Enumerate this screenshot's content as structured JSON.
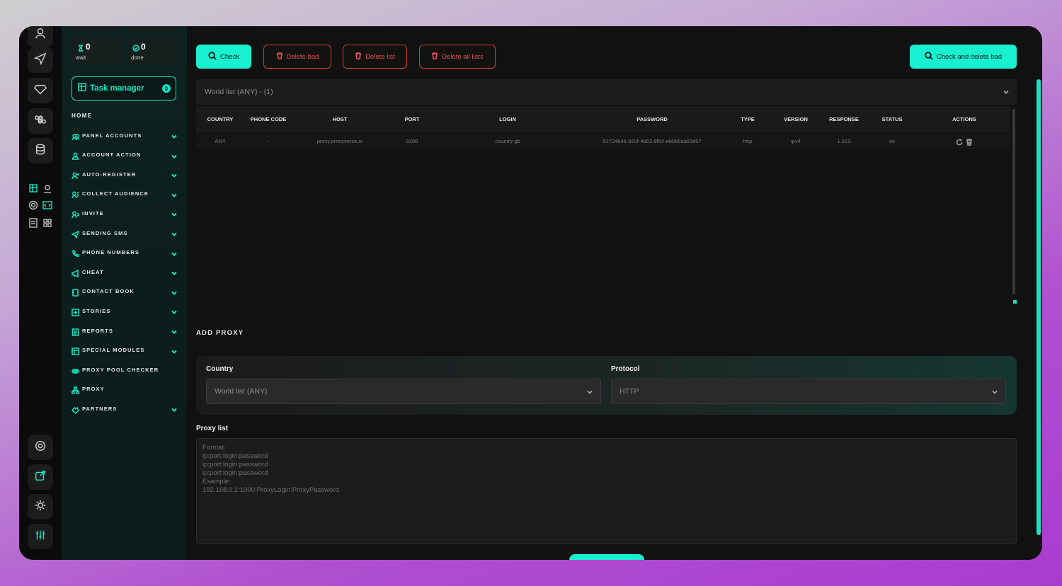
{
  "sidebar": {
    "stats": [
      {
        "value": "0",
        "label": "wait"
      },
      {
        "value": "0",
        "label": "done"
      }
    ],
    "task_manager": {
      "label": "Task manager",
      "badge": "0"
    },
    "home": "HOME",
    "items": [
      {
        "label": "PANEL ACCOUNTS",
        "icon": "users-icon",
        "has_chevron": true
      },
      {
        "label": "ACCOUNT ACTION",
        "icon": "user-icon",
        "has_chevron": true
      },
      {
        "label": "AUTO-REGISTER",
        "icon": "user-plus-icon",
        "has_chevron": true
      },
      {
        "label": "COLLECT AUDIENCE",
        "icon": "user-group-icon",
        "has_chevron": true
      },
      {
        "label": "INVITE",
        "icon": "user-add-icon",
        "has_chevron": true
      },
      {
        "label": "SENDING SMS",
        "icon": "send-icon",
        "has_chevron": true
      },
      {
        "label": "PHONE NUMBERS",
        "icon": "phone-icon",
        "has_chevron": true
      },
      {
        "label": "CHEAT",
        "icon": "megaphone-icon",
        "has_chevron": true
      },
      {
        "label": "CONTACT BOOK",
        "icon": "book-icon",
        "has_chevron": true
      },
      {
        "label": "STORIES",
        "icon": "plus-square-icon",
        "has_chevron": true
      },
      {
        "label": "REPORTS",
        "icon": "report-icon",
        "has_chevron": true
      },
      {
        "label": "SPECIAL MODULES",
        "icon": "modules-icon",
        "has_chevron": true
      },
      {
        "label": "PROXY POOL CHECKER",
        "icon": "pool-icon",
        "has_chevron": false
      },
      {
        "label": "PROXY",
        "icon": "network-icon",
        "has_chevron": false
      },
      {
        "label": "PARTNERS",
        "icon": "handshake-icon",
        "has_chevron": true
      }
    ]
  },
  "toolbar": {
    "check": "Check",
    "delete_bad": "Delete bad",
    "delete_list": "Delete list",
    "delete_all_lists": "Delete all lists",
    "check_and_delete_bad": "Check and delete bad"
  },
  "list_select": {
    "value": "World list (ANY) - (1)"
  },
  "table": {
    "headers": [
      "COUNTRY",
      "PHONE CODE",
      "HOST",
      "PORT",
      "LOGIN",
      "PASSWORD",
      "TYPE",
      "VERSION",
      "RESPONSE",
      "STATUS",
      "ACTIONS"
    ],
    "rows": [
      [
        "ANY",
        "-",
        "proxy.proxyverse.io",
        "9200",
        "country-gb",
        "51724b46-920f-4a53-8f54-eb0b5aa63d67",
        "http",
        "ipv4",
        "1.813",
        "ok"
      ]
    ]
  },
  "add_proxy": {
    "title": "ADD PROXY",
    "country_label": "Country",
    "country_value": "World list (ANY)",
    "protocol_label": "Protocol",
    "protocol_value": "HTTP",
    "proxy_list_label": "Proxy list",
    "placeholder_lines": [
      "Format:",
      "ip:port:login:password",
      "ip:port:login:password",
      "ip:port:login:password",
      "Example:",
      "192.168.0.1:1000:ProxyLogin:ProxyPassword"
    ]
  },
  "colors": {
    "accent": "#19f0cf",
    "danger": "#e05555",
    "background": "#111111"
  }
}
